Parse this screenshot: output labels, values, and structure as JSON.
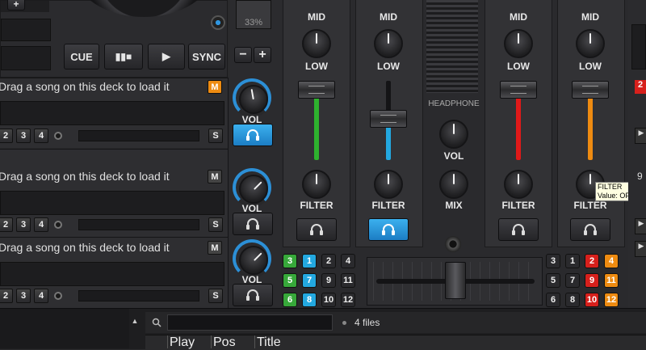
{
  "top_left": {
    "plus_label": "+",
    "pitch_value": "33%",
    "cue_label": "CUE",
    "play_pause_label": "▮▮■",
    "play_label": "▶",
    "sync_label": "SYNC",
    "minus_label": "−",
    "plus2_label": "+"
  },
  "decks": [
    {
      "message": "Drag a song on this deck to load it",
      "m_label": "M",
      "m_active": true,
      "hotcues": [
        "2",
        "3",
        "4"
      ],
      "s_label": "S",
      "vol_label": "VOL",
      "headphone_active": true
    },
    {
      "message": "Drag a song on this deck to load it",
      "m_label": "M",
      "m_active": false,
      "hotcues": [
        "2",
        "3",
        "4"
      ],
      "s_label": "S",
      "vol_label": "VOL",
      "headphone_active": false
    },
    {
      "message": "Drag a song on this deck to load it",
      "m_label": "M",
      "m_active": false,
      "hotcues": [
        "2",
        "3",
        "4"
      ],
      "s_label": "S",
      "vol_label": "VOL",
      "headphone_active": false
    }
  ],
  "mixer": {
    "channels": [
      {
        "mid": "MID",
        "low": "LOW",
        "filter": "FILTER",
        "fader_color": "#2eb22e",
        "headphone_active": false
      },
      {
        "mid": "MID",
        "low": "LOW",
        "filter": "FILTER",
        "fader_color": "#23a8e0",
        "headphone_active": true
      },
      {
        "mid": "MID",
        "low": "LOW",
        "filter": "FILTER",
        "fader_color": "#e01919",
        "headphone_active": false
      },
      {
        "mid": "MID",
        "low": "LOW",
        "filter": "FILTER",
        "fader_color": "#ee8b11",
        "headphone_active": false
      }
    ],
    "headphone_label": "HEADPHONE",
    "vol_label": "VOL",
    "mix_label": "MIX",
    "tooltip_title": "FILTER",
    "tooltip_value": "Value: OFF"
  },
  "left_pads": [
    [
      {
        "label": "3",
        "color": "green"
      },
      {
        "label": "1",
        "color": "blue"
      },
      {
        "label": "2",
        "color": "gray"
      },
      {
        "label": "4",
        "color": "gray"
      }
    ],
    [
      {
        "label": "5",
        "color": "green"
      },
      {
        "label": "7",
        "color": "blue"
      },
      {
        "label": "9",
        "color": "gray"
      },
      {
        "label": "11",
        "color": "gray"
      }
    ],
    [
      {
        "label": "6",
        "color": "green"
      },
      {
        "label": "8",
        "color": "blue"
      },
      {
        "label": "10",
        "color": "gray"
      },
      {
        "label": "12",
        "color": "gray"
      }
    ]
  ],
  "right_pads": [
    [
      {
        "label": "3",
        "color": "gray"
      },
      {
        "label": "1",
        "color": "gray"
      },
      {
        "label": "2",
        "color": "red"
      },
      {
        "label": "4",
        "color": "orange"
      }
    ],
    [
      {
        "label": "5",
        "color": "gray"
      },
      {
        "label": "7",
        "color": "gray"
      },
      {
        "label": "9",
        "color": "red"
      },
      {
        "label": "11",
        "color": "orange"
      }
    ],
    [
      {
        "label": "6",
        "color": "gray"
      },
      {
        "label": "8",
        "color": "gray"
      },
      {
        "label": "10",
        "color": "red"
      },
      {
        "label": "12",
        "color": "orange"
      }
    ]
  ],
  "crossfader": {
    "position": 0.5
  },
  "right_edge": {
    "tab_label": "2",
    "nine_label": "9"
  },
  "browser": {
    "search_placeholder": "",
    "file_count": "4 files",
    "columns": [
      "Play",
      "Pos",
      "Title"
    ]
  },
  "colors": {
    "accent_blue": "#23a8e0",
    "accent_orange": "#ee8b11",
    "accent_red": "#e01919",
    "accent_green": "#2eb22e"
  },
  "icons": [
    "headphone-icon",
    "search-icon",
    "play-icon",
    "add-icon"
  ]
}
